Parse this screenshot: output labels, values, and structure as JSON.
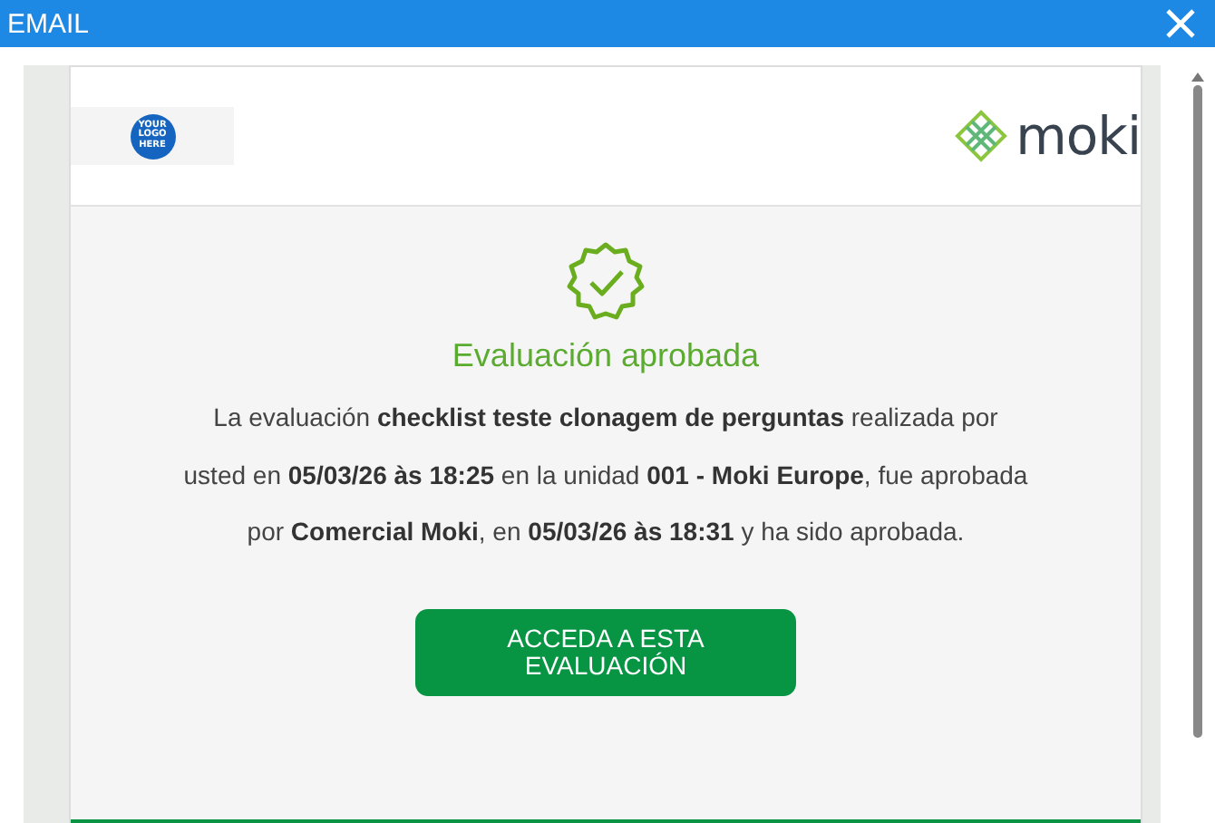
{
  "window": {
    "title": "EMAIL"
  },
  "header": {
    "logo_placeholder": "YOUR LOGO HERE",
    "brand": "moki"
  },
  "message": {
    "heading": "Evaluación aprobada",
    "body": "La evaluación **checklist teste clonagem de perguntas** realizada por usted en **05/03/26 às 18:25** en la unidad **001 - Moki Europe**, fue aprobada por **Comercial Moki**, en **05/03/26 às 18:31** y ha sido aprobada.",
    "button": "ACCEDA A ESTA EVALUACIÓN"
  }
}
